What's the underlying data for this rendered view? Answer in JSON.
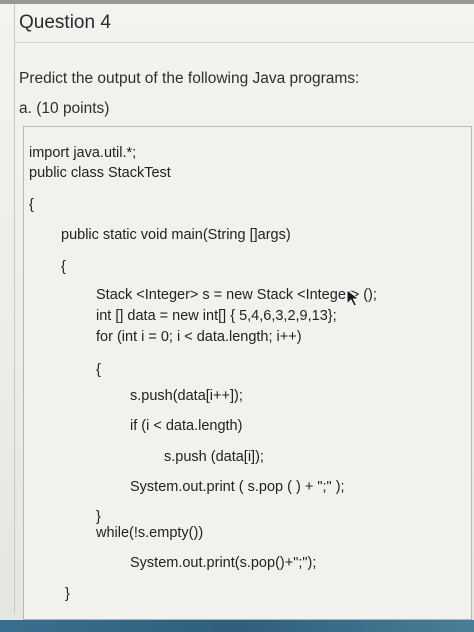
{
  "question": {
    "title": "Question 4",
    "prompt": "Predict the output of the following Java programs:",
    "part": "a. (10 points)"
  },
  "code": {
    "lines": [
      "import java.util.*;",
      "public class StackTest",
      "{",
      "public static void main(String []args)",
      "{",
      "Stack <Integer> s = new Stack <Integer> ();",
      "int [] data = new int[] { 5,4,6,3,2,9,13};",
      "for (int i = 0; i < data.length; i++)",
      "{",
      "s.push(data[i++]);",
      "if (i < data.length)",
      "s.push (data[i]);",
      "System.out.print ( s.pop ( ) + \";\" );",
      "}",
      "while(!s.empty())",
      "System.out.print(s.pop()+\";\");",
      "}"
    ]
  },
  "icons": {
    "cursor": "mouse-pointer-icon"
  },
  "colors": {
    "page": "#f3f3f0",
    "text": "#2a2a2a",
    "taskbar": "#3b6f8e"
  }
}
